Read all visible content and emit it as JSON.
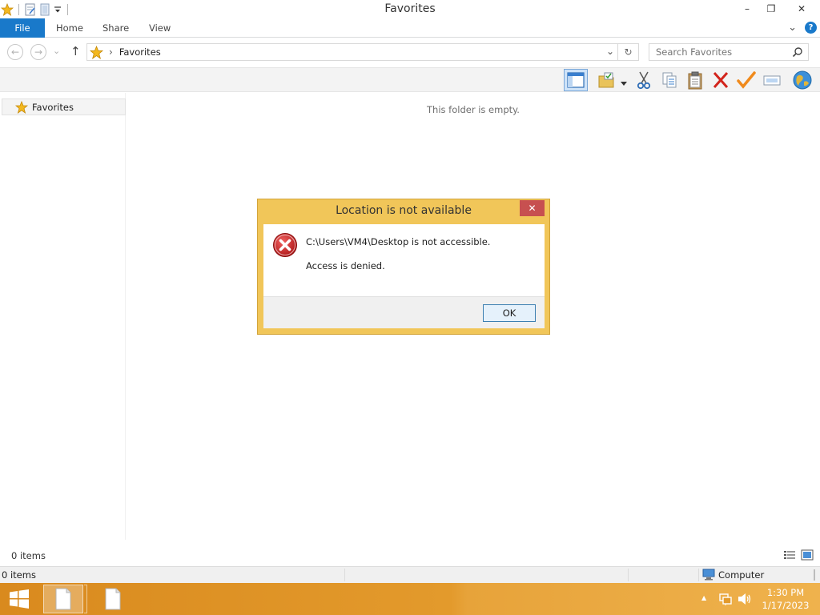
{
  "window": {
    "title": "Favorites"
  },
  "quick_access": {
    "icons": [
      "favorites-star-icon",
      "properties-icon",
      "new-folder-icon",
      "customize-qat-icon"
    ]
  },
  "window_controls": {
    "minimize": "–",
    "restore": "❐",
    "close": "✕"
  },
  "ribbon": {
    "tabs": [
      {
        "label": "File"
      },
      {
        "label": "Home"
      },
      {
        "label": "Share"
      },
      {
        "label": "View"
      }
    ],
    "expand_glyph": "⌄",
    "help_glyph": "?"
  },
  "address_bar": {
    "location": "Favorites",
    "back_glyph": "←",
    "forward_glyph": "→",
    "recent_glyph": "⌄",
    "up_glyph": "↑",
    "breadcrumb_separator": "›",
    "dropdown_glyph": "⌄",
    "refresh_glyph": "↻"
  },
  "search": {
    "placeholder": "Search Favorites"
  },
  "toolbar": {
    "icons": [
      "preview-pane-icon",
      "move-to-folder-icon",
      "cut-icon",
      "copy-icon",
      "paste-icon",
      "delete-icon",
      "checkmark-icon",
      "rename-icon",
      "globe-icon"
    ]
  },
  "nav_pane": {
    "items": [
      {
        "label": "Favorites"
      }
    ]
  },
  "content": {
    "empty_message": "This folder is empty."
  },
  "status_bar": {
    "items_count": "0 items"
  },
  "details_bar": {
    "items_count": "0 items",
    "location": "Computer"
  },
  "dialog": {
    "title": "Location is not available",
    "close_glyph": "✕",
    "message": "C:\\Users\\VM4\\Desktop is not accessible.",
    "detail": "Access is denied.",
    "ok_label": "OK"
  },
  "taskbar": {
    "time": "1:30 PM",
    "date": "1/17/2023",
    "tray_expand_glyph": "▲"
  },
  "colors": {
    "file_tab": "#1979ca",
    "dialog_frame": "#f1c659",
    "dialog_close": "#c75050",
    "taskbar": "#e39a2c",
    "error_icon": "#c62828"
  }
}
